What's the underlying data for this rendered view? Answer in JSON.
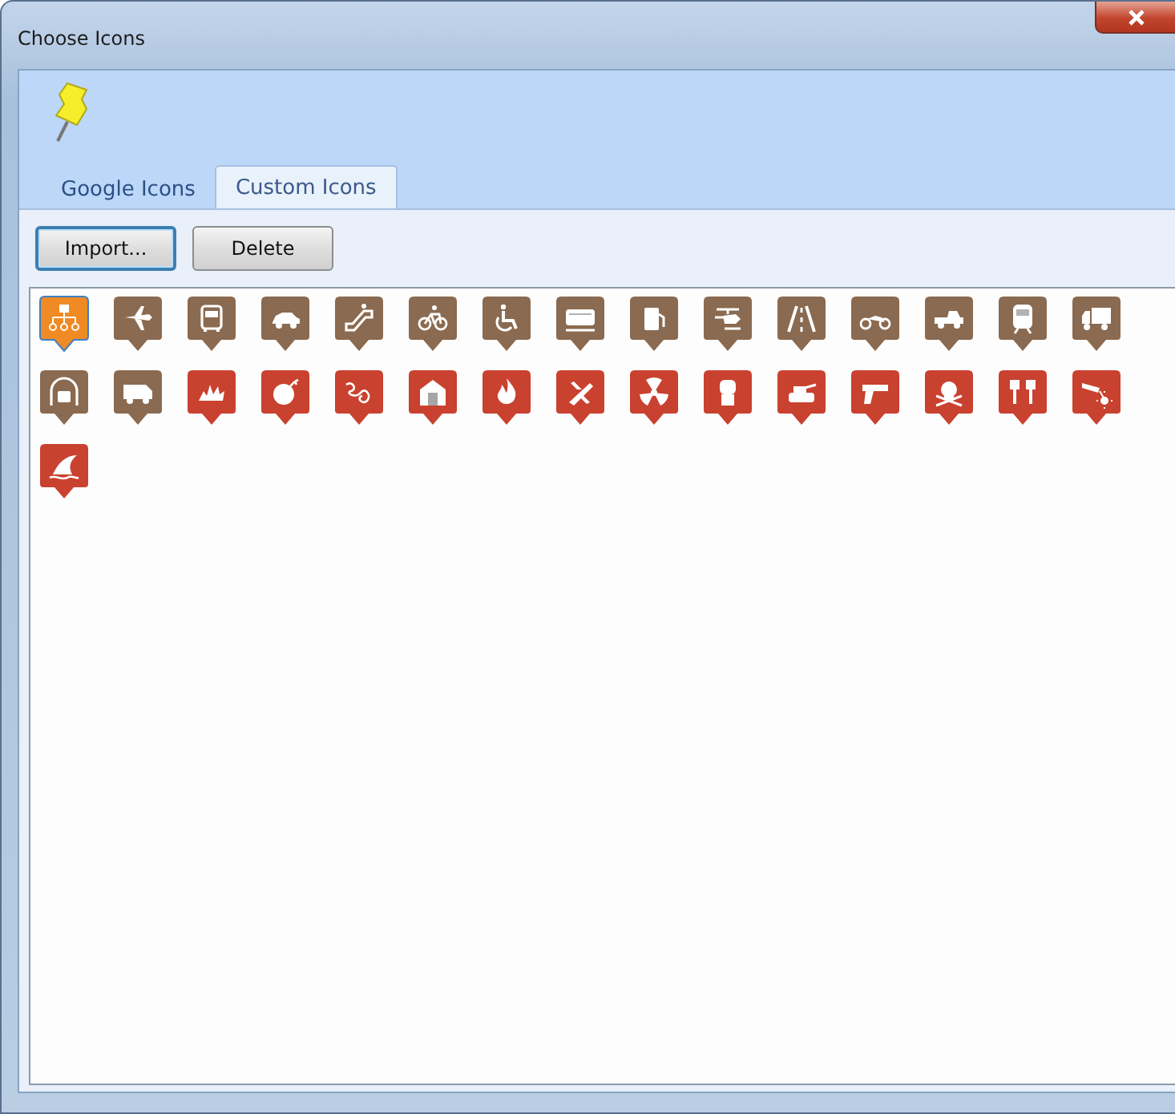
{
  "window": {
    "title": "Choose Icons"
  },
  "tabs": [
    {
      "label": "Google Icons",
      "selected": false
    },
    {
      "label": "Custom Icons",
      "selected": true
    }
  ],
  "buttons": [
    {
      "label": "Import...",
      "kind": "default"
    },
    {
      "label": "Delete",
      "kind": "normal"
    }
  ],
  "icons": [
    {
      "kind": "network",
      "color": "#f08a24",
      "selected": true
    },
    {
      "kind": "plane",
      "color": "#8a6a50",
      "selected": false
    },
    {
      "kind": "bus",
      "color": "#8a6a50",
      "selected": false
    },
    {
      "kind": "car",
      "color": "#8a6a50",
      "selected": false
    },
    {
      "kind": "escalator",
      "color": "#8a6a50",
      "selected": false
    },
    {
      "kind": "bicycle",
      "color": "#8a6a50",
      "selected": false
    },
    {
      "kind": "wheelchair",
      "color": "#8a6a50",
      "selected": false
    },
    {
      "kind": "tram",
      "color": "#8a6a50",
      "selected": false
    },
    {
      "kind": "fuel",
      "color": "#8a6a50",
      "selected": false
    },
    {
      "kind": "helicopter",
      "color": "#8a6a50",
      "selected": false
    },
    {
      "kind": "road",
      "color": "#8a6a50",
      "selected": false
    },
    {
      "kind": "motorcycle",
      "color": "#8a6a50",
      "selected": false
    },
    {
      "kind": "pickup",
      "color": "#8a6a50",
      "selected": false
    },
    {
      "kind": "train",
      "color": "#8a6a50",
      "selected": false
    },
    {
      "kind": "truck",
      "color": "#8a6a50",
      "selected": false
    },
    {
      "kind": "tunnel",
      "color": "#8a6a50",
      "selected": false
    },
    {
      "kind": "van",
      "color": "#8a6a50",
      "selected": false
    },
    {
      "kind": "explosion",
      "color": "#c9412f",
      "selected": false
    },
    {
      "kind": "bomb",
      "color": "#c9412f",
      "selected": false
    },
    {
      "kind": "scribble",
      "color": "#c9412f",
      "selected": false
    },
    {
      "kind": "building",
      "color": "#c9412f",
      "selected": false
    },
    {
      "kind": "fire",
      "color": "#c9412f",
      "selected": false
    },
    {
      "kind": "crash",
      "color": "#c9412f",
      "selected": false
    },
    {
      "kind": "radiation",
      "color": "#c9412f",
      "selected": false
    },
    {
      "kind": "fist",
      "color": "#c9412f",
      "selected": false
    },
    {
      "kind": "tank",
      "color": "#c9412f",
      "selected": false
    },
    {
      "kind": "gun",
      "color": "#c9412f",
      "selected": false
    },
    {
      "kind": "skull",
      "color": "#c9412f",
      "selected": false
    },
    {
      "kind": "brushes",
      "color": "#c9412f",
      "selected": false
    },
    {
      "kind": "laser",
      "color": "#c9412f",
      "selected": false
    },
    {
      "kind": "fin",
      "color": "#c9412f",
      "selected": false
    }
  ]
}
